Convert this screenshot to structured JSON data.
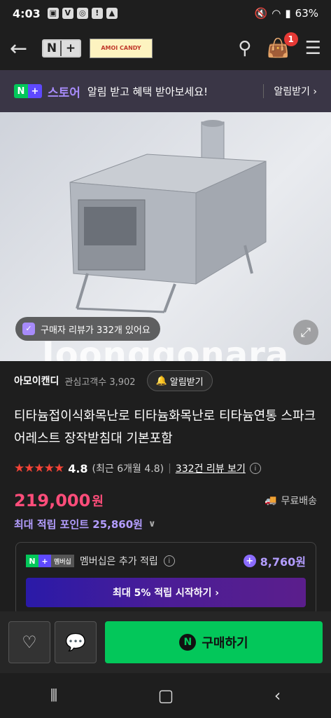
{
  "status": {
    "time": "4:03",
    "battery": "63%",
    "icons": [
      "gallery-icon",
      "v-icon",
      "chrome-icon",
      "warning-icon",
      "image-icon"
    ]
  },
  "nav": {
    "logo_n": "N",
    "logo_plus": "+",
    "shop_logo_text": "AMOI CANDY",
    "cart_count": "1"
  },
  "banner": {
    "store_label": "스토어",
    "text": "알림 받고 혜택 받아보세요!",
    "cta": "알림받기 ›"
  },
  "hero": {
    "review_pill": "구매자 리뷰가 332개 있어요",
    "watermark": "Joonggonara"
  },
  "seller": {
    "name": "아모이캔디",
    "followers": "관심고객수 3,902",
    "follow_btn": "알림받기"
  },
  "product": {
    "title": "티타늄접이식화목난로 티타늄화목난로 티타늄연통 스파크어레스트 장작받침대 기본포함"
  },
  "rating": {
    "stars": "★★★★★",
    "value": "4.8",
    "recent": "(최근 6개월 4.8)",
    "review_link": "332건 리뷰 보기"
  },
  "price": {
    "amount": "219,000",
    "unit": "원",
    "shipping": "무료배송"
  },
  "points": {
    "label": "최대 적립 포인트 25,860원"
  },
  "membership": {
    "badge_label": "멤버십",
    "text": "멤버십은 추가 적립",
    "points": "8,760원",
    "cta": "최대 5% 적립 시작하기 ›"
  },
  "bottom": {
    "buy_label": "구매하기"
  },
  "colors": {
    "accent_green": "#03c75a",
    "price_pink": "#ff4d7a",
    "purple": "#b39dff"
  }
}
